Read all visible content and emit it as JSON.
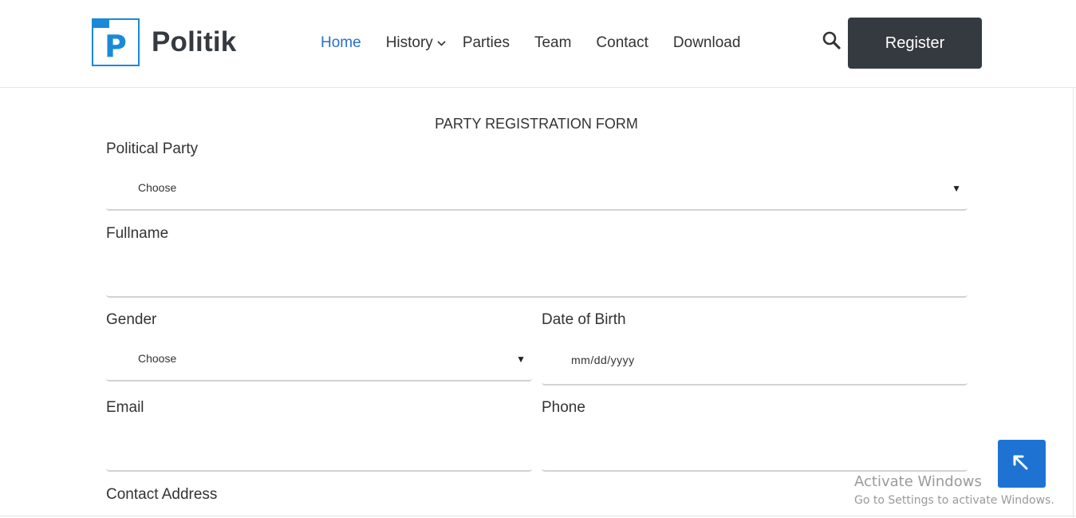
{
  "header": {
    "logo_letter": "P",
    "logo_text": "Politik",
    "nav": [
      {
        "label": "Home",
        "active": true
      },
      {
        "label": "History",
        "dropdown": true
      },
      {
        "label": "Parties"
      },
      {
        "label": "Team"
      },
      {
        "label": "Contact"
      },
      {
        "label": "Download"
      }
    ],
    "search_icon": "search-icon",
    "register_label": "Register"
  },
  "form": {
    "title": "PARTY REGISTRATION FORM",
    "political_party": {
      "label": "Political Party",
      "value": "Choose"
    },
    "fullname": {
      "label": "Fullname",
      "value": ""
    },
    "gender": {
      "label": "Gender",
      "value": "Choose"
    },
    "dob": {
      "label": "Date of Birth",
      "value": "mm/dd/yyyy"
    },
    "email": {
      "label": "Email",
      "value": ""
    },
    "phone": {
      "label": "Phone",
      "value": ""
    },
    "contact_address": {
      "label": "Contact Address"
    }
  },
  "scroll_top_icon": "arrow-up-left-icon",
  "watermark": {
    "title": "Activate Windows",
    "subtitle": "Go to Settings to activate Windows."
  },
  "colors": {
    "brand": "#1a8ad8",
    "nav_active": "#2a6fc7",
    "register_bg": "#343a40",
    "scroll_top_bg": "#1e73d2"
  }
}
